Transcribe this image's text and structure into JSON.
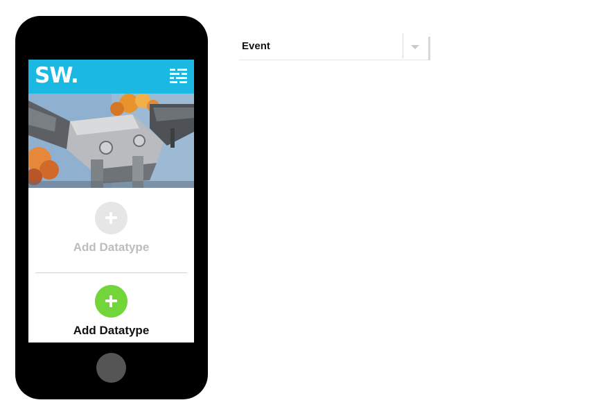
{
  "app": {
    "logo": "SW."
  },
  "datatype_disabled": {
    "label": "Add Datatype",
    "icon": "plus-icon",
    "color": "#e6e6e6"
  },
  "datatype_enabled": {
    "label": "Add Datatype",
    "icon": "plus-icon",
    "color": "#72d63a"
  },
  "event_select": {
    "value": "Event",
    "icon": "caret-down-icon"
  },
  "colors": {
    "header": "#1ab8e2",
    "phone": "#000000"
  }
}
